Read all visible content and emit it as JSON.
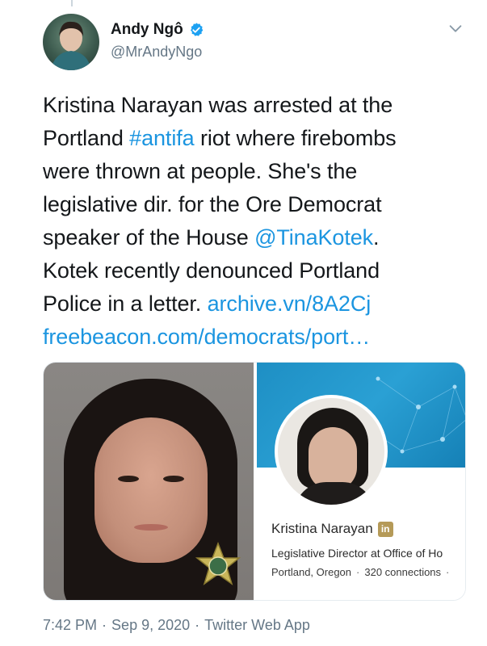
{
  "author": {
    "display_name": "Andy Ngô",
    "handle": "@MrAndyNgo",
    "verified": true
  },
  "tweet": {
    "segments": [
      [
        {
          "text": "Kristina Narayan was arrested at the",
          "link": false
        }
      ],
      [
        {
          "text": "Portland ",
          "link": false
        },
        {
          "text": "#antifa",
          "link": true
        },
        {
          "text": " riot where firebombs",
          "link": false
        }
      ],
      [
        {
          "text": "were thrown at people. She's the",
          "link": false
        }
      ],
      [
        {
          "text": "legislative dir. for the Ore Democrat",
          "link": false
        }
      ],
      [
        {
          "text": "speaker of the House ",
          "link": false
        },
        {
          "text": "@TinaKotek",
          "link": true
        },
        {
          "text": ".",
          "link": false
        }
      ],
      [
        {
          "text": "Kotek recently denounced Portland",
          "link": false
        }
      ],
      [
        {
          "text": "Police in a letter. ",
          "link": false
        },
        {
          "text": "archive.vn/8A2Cj",
          "link": true
        }
      ],
      [
        {
          "text": "freebeacon.com/democrats/port…",
          "link": true
        }
      ]
    ]
  },
  "media": {
    "profile_card": {
      "name": "Kristina Narayan",
      "badge_text": "in",
      "title": "Legislative Director at Office of Ho",
      "location": "Portland, Oregon",
      "separator": "·",
      "connections": "320 connections",
      "trailing": "·"
    }
  },
  "footer": {
    "time": "7:42 PM",
    "date": "Sep 9, 2020",
    "source": "Twitter Web App",
    "separator": "·"
  },
  "colors": {
    "link": "#1b95e0",
    "secondary_text": "#657786",
    "verified": "#1da1f2",
    "linkedin_badge": "#b59a58"
  },
  "icons": [
    "verified-icon",
    "chevron-down-icon",
    "police-badge-icon",
    "linkedin-icon"
  ]
}
